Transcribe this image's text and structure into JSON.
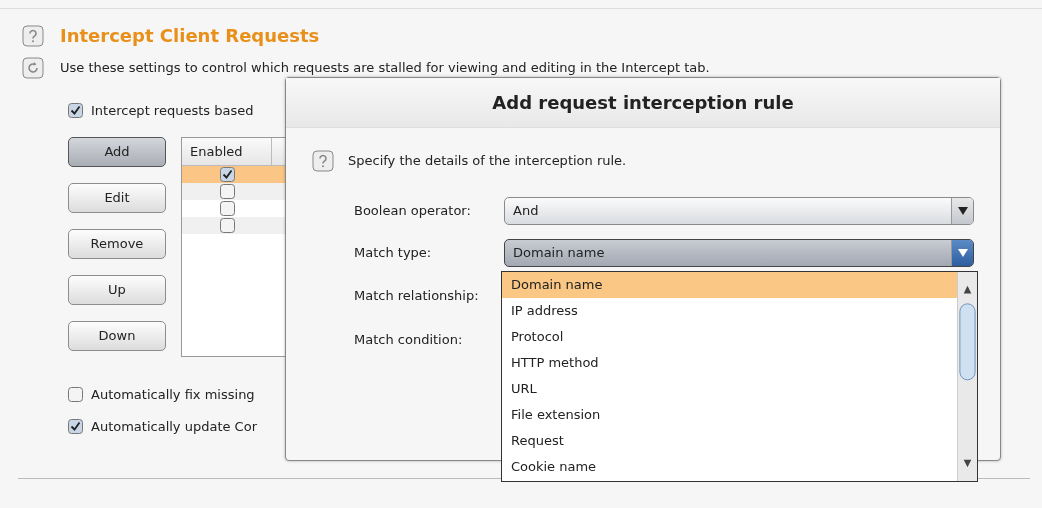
{
  "section": {
    "title": "Intercept Client Requests",
    "description": "Use these settings to control which requests are stalled for viewing and editing in the Intercept tab."
  },
  "intercept_checkbox": {
    "label": "Intercept requests based",
    "checked": true
  },
  "buttons": [
    {
      "label": "Add",
      "focused": true
    },
    {
      "label": "Edit",
      "focused": false
    },
    {
      "label": "Remove",
      "focused": false
    },
    {
      "label": "Up",
      "focused": false
    },
    {
      "label": "Down",
      "focused": false
    }
  ],
  "table": {
    "columns": [
      "Enabled"
    ],
    "rows": [
      {
        "enabled": true,
        "selected": true
      },
      {
        "enabled": false,
        "selected": false
      },
      {
        "enabled": false,
        "selected": false
      },
      {
        "enabled": false,
        "selected": false
      }
    ]
  },
  "options": [
    {
      "label": "Automatically fix missing",
      "checked": false
    },
    {
      "label": "Automatically update Cor",
      "checked": true
    }
  ],
  "dialog": {
    "title": "Add request interception rule",
    "intro": "Specify the details of the interception rule.",
    "fields": [
      {
        "label": "Boolean operator:",
        "kind": "combo",
        "value": "And",
        "focused": false
      },
      {
        "label": "Match type:",
        "kind": "combo",
        "value": "Domain name",
        "focused": true
      },
      {
        "label": "Match relationship:",
        "kind": "label"
      },
      {
        "label": "Match condition:",
        "kind": "label"
      }
    ],
    "dropdown": {
      "items": [
        {
          "label": "Domain name",
          "selected": true
        },
        {
          "label": "IP address",
          "selected": false
        },
        {
          "label": "Protocol",
          "selected": false
        },
        {
          "label": "HTTP method",
          "selected": false
        },
        {
          "label": "URL",
          "selected": false
        },
        {
          "label": "File extension",
          "selected": false
        },
        {
          "label": "Request",
          "selected": false
        },
        {
          "label": "Cookie name",
          "selected": false
        }
      ]
    }
  }
}
